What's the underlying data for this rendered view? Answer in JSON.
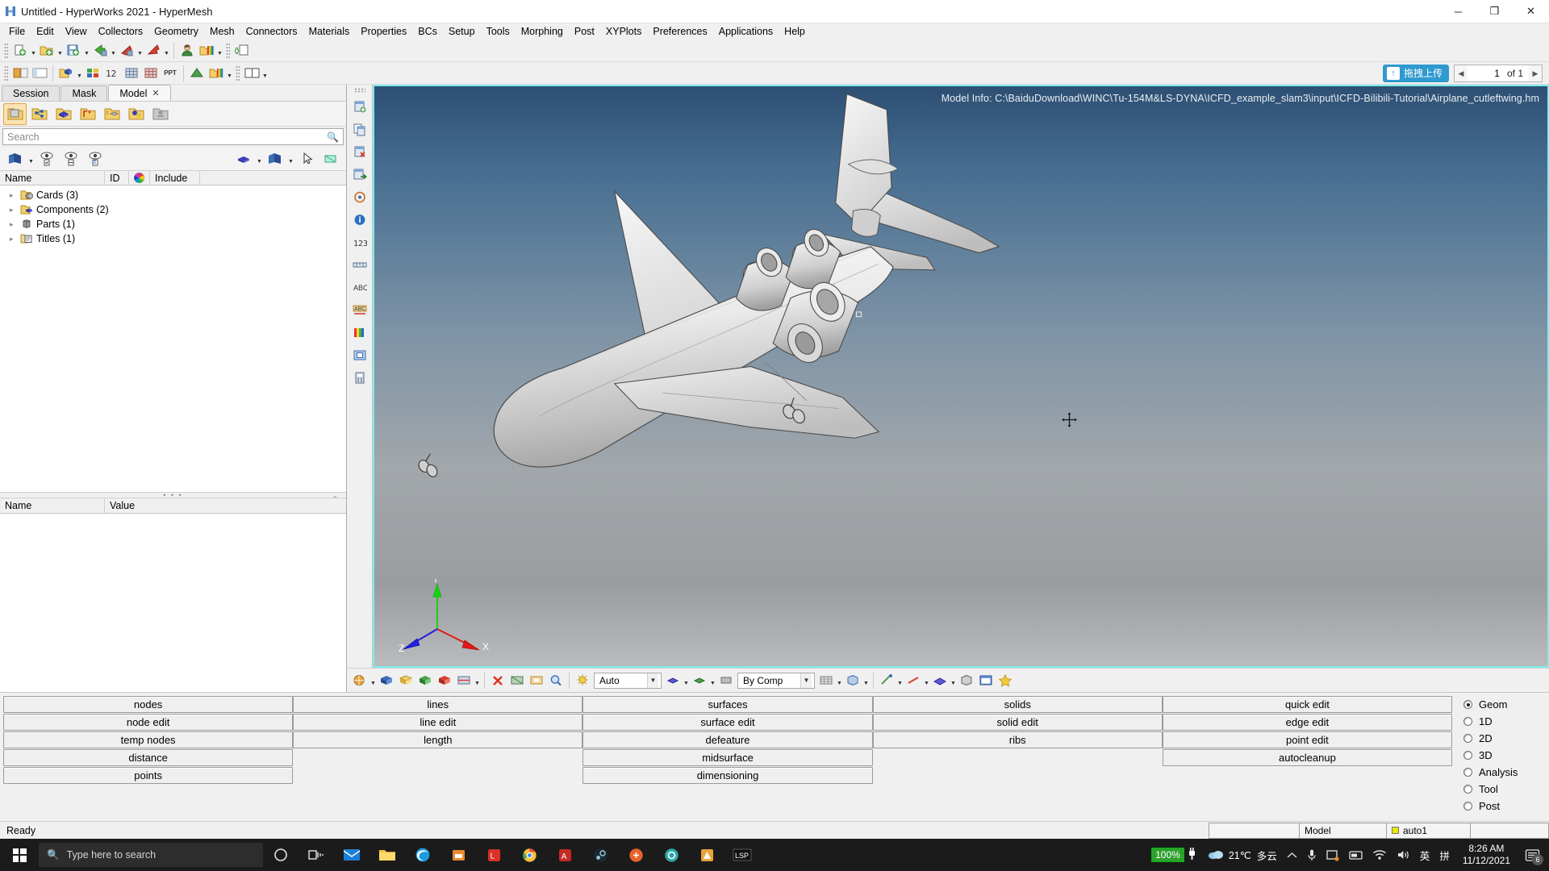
{
  "window": {
    "title": "Untitled - HyperWorks 2021 - HyperMesh",
    "logo": "hyperworks-logo",
    "minimize": "─",
    "maximize": "❐",
    "close": "✕"
  },
  "menubar": {
    "items": [
      "File",
      "Edit",
      "View",
      "Collectors",
      "Geometry",
      "Mesh",
      "Connectors",
      "Materials",
      "Properties",
      "BCs",
      "Setup",
      "Tools",
      "Morphing",
      "Post",
      "XYPlots",
      "Preferences",
      "Applications",
      "Help"
    ]
  },
  "toolbar": {
    "upload_label": "拖拽上传",
    "page_current": "1",
    "page_total": "of 1",
    "icons": [
      "new-model-icon",
      "open-model-icon",
      "save-model-icon",
      "import-icon",
      "export-icon",
      "export-solver-icon",
      "user-profile-icon",
      "color-palette-icon",
      "add-include-icon",
      "add-component-icon",
      "add-property-icon",
      "mesh-icon",
      "mesh-2d-icon",
      "ppt-icon",
      "contour-icon",
      "legend-icon",
      "window-layout-icon"
    ]
  },
  "browser": {
    "tabs": [
      {
        "label": "Session",
        "active": false,
        "closable": false
      },
      {
        "label": "Mask",
        "active": false,
        "closable": false
      },
      {
        "label": "Model",
        "active": true,
        "closable": true
      }
    ],
    "entity_icons": [
      "components-folder-icon",
      "connectors-folder-icon",
      "materials-folder-icon",
      "loadcollectors-folder-icon",
      "properties-folder-icon",
      "groups-folder-icon",
      "includes-folder-icon"
    ],
    "search_placeholder": "Search",
    "search_value": "",
    "view_icons": [
      "display-all-icon",
      "show-icon",
      "hide-icon",
      "reverse-icon",
      "color-mode-icon",
      "display-mode-icon",
      "select-cursor-icon",
      "isolate-icon"
    ],
    "columns": [
      "Name",
      "ID",
      "Include"
    ],
    "color_column_icon": "color-wheel-icon",
    "tree": [
      {
        "label": "Cards (3)",
        "icon": "cards-folder-icon"
      },
      {
        "label": "Components (2)",
        "icon": "components-folder-icon"
      },
      {
        "label": "Parts (1)",
        "icon": "parts-icon"
      },
      {
        "label": "Titles (1)",
        "icon": "titles-folder-icon"
      }
    ],
    "property_columns": [
      "Name",
      "Value"
    ]
  },
  "viewport": {
    "model_info": "Model Info: C:\\BaiduDownload\\WINC\\Tu-154M&LS-DYNA\\ICFD_example_slam3\\input\\ICFD-Bilibili-Tutorial\\Airplane_cutleftwing.hm",
    "axis_x": "X",
    "axis_y": "Y",
    "axis_z": "Z",
    "border_color": "#7fecec",
    "left_tool_icons": [
      "page-add-icon",
      "page-copy-icon",
      "page-delete-icon",
      "page-next-icon",
      "circle-select-icon",
      "info-icon",
      "count-123-icon",
      "distance-icon",
      "abc-text-icon",
      "abc-edit-icon",
      "color-bar-icon",
      "shrink-icon",
      "mass-calc-icon"
    ],
    "bottom_toolbar": {
      "display_mode": "By Comp",
      "auto_label": "Auto",
      "icons": [
        "visualization-icon",
        "shaded-geom-icon",
        "wireframe-geom-icon",
        "shaded-mesh-icon",
        "wireframe-mesh-icon",
        "feature-lines-icon",
        "mesh-lines-icon",
        "delete-icon",
        "mask-icon",
        "isolate-icon",
        "find-icon",
        "light-icon",
        "element-color-icon",
        "component-color-icon",
        "assembly-color-icon",
        "node-icon",
        "line-icon",
        "surface-icon",
        "solid-icon",
        "plane-icon",
        "window-icon",
        "favorite-star-icon"
      ]
    }
  },
  "command_panel": {
    "columns": [
      {
        "buttons": [
          "nodes",
          "node edit",
          "temp nodes",
          "distance",
          "points"
        ]
      },
      {
        "buttons": [
          "lines",
          "line edit",
          "length",
          "",
          ""
        ]
      },
      {
        "buttons": [
          "surfaces",
          "surface edit",
          "defeature",
          "midsurface",
          "dimensioning"
        ]
      },
      {
        "buttons": [
          "solids",
          "solid edit",
          "ribs",
          "",
          ""
        ]
      },
      {
        "buttons": [
          "quick edit",
          "edge edit",
          "point edit",
          "autocleanup",
          ""
        ]
      }
    ],
    "modes": [
      {
        "label": "Geom",
        "selected": true
      },
      {
        "label": "1D",
        "selected": false
      },
      {
        "label": "2D",
        "selected": false
      },
      {
        "label": "3D",
        "selected": false
      },
      {
        "label": "Analysis",
        "selected": false
      },
      {
        "label": "Tool",
        "selected": false
      },
      {
        "label": "Post",
        "selected": false
      }
    ]
  },
  "statusbar": {
    "message": "Ready",
    "field_blank": "",
    "field_model": "Model",
    "field_auto": "auto1"
  },
  "taskbar": {
    "search_placeholder": "Type here to search",
    "search_icon": "search-icon",
    "start_icon": "windows-start-icon",
    "cortana_icon": "cortana-circle-icon",
    "taskview_icon": "task-view-icon",
    "apps": [
      "mail-icon",
      "file-explorer-icon",
      "edge-icon",
      "store-icon",
      "wps-icon",
      "chrome-icon",
      "acrobat-icon",
      "steam-icon",
      "app-orange-icon",
      "app-teal-icon",
      "hypermesh-icon",
      "lsprepost-icon"
    ],
    "battery_percent": "100%",
    "battery_icon": "plug-icon",
    "weather_temp": "21℃",
    "weather_text": "多云",
    "weather_icon": "cloud-icon",
    "tray_icons": [
      "chevron-up-icon",
      "microphone-icon",
      "screenshot-icon",
      "input-tool-icon",
      "wifi-icon",
      "volume-icon"
    ],
    "ime_lang": "英",
    "ime_mode": "拼",
    "time": "8:26 AM",
    "date": "11/12/2021",
    "notification_count": "6",
    "notification_icon": "action-center-icon"
  }
}
